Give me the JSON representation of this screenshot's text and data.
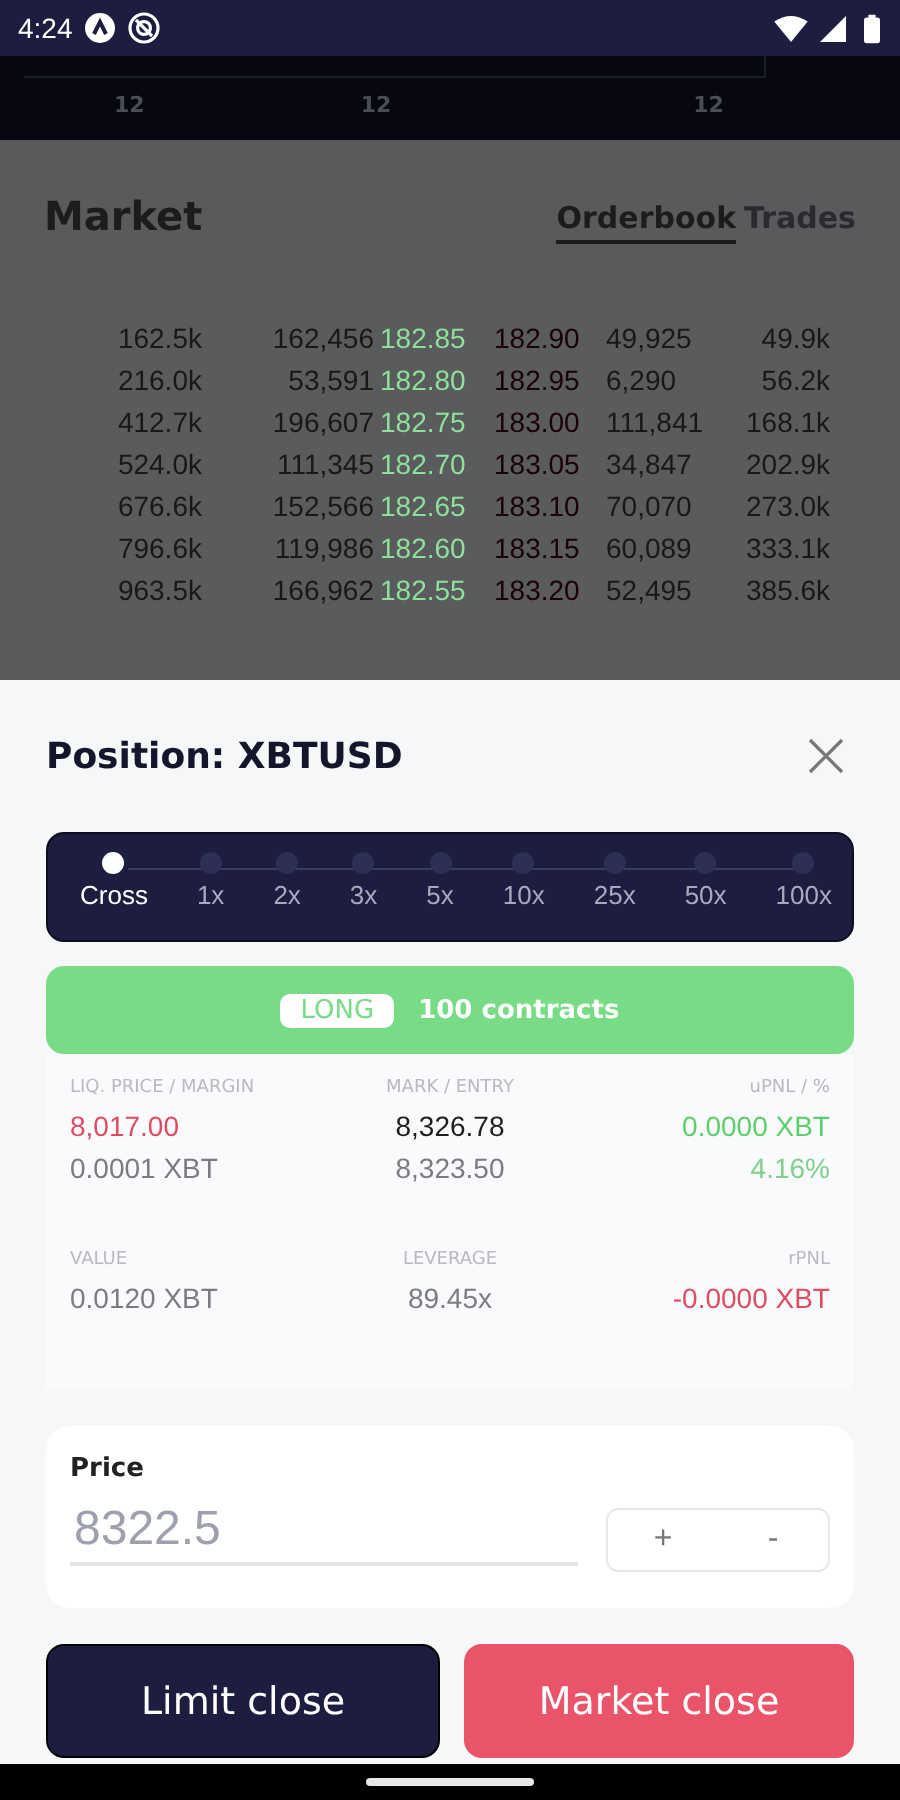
{
  "status_bar": {
    "time": "4:24"
  },
  "chart_axis": {
    "labels": [
      "12",
      "12",
      "12"
    ]
  },
  "market": {
    "title": "Market",
    "tabs": [
      {
        "label": "Orderbook",
        "selected": true
      },
      {
        "label": "Trades",
        "selected": false
      }
    ],
    "orderbook": [
      {
        "bid_total": "162.5k",
        "bid_size": "162,456",
        "bid_price": "182.85",
        "ask_price": "182.90",
        "ask_size": "49,925",
        "ask_total": "49.9k"
      },
      {
        "bid_total": "216.0k",
        "bid_size": "53,591",
        "bid_price": "182.80",
        "ask_price": "182.95",
        "ask_size": "6,290",
        "ask_total": "56.2k"
      },
      {
        "bid_total": "412.7k",
        "bid_size": "196,607",
        "bid_price": "182.75",
        "ask_price": "183.00",
        "ask_size": "111,841",
        "ask_total": "168.1k"
      },
      {
        "bid_total": "524.0k",
        "bid_size": "111,345",
        "bid_price": "182.70",
        "ask_price": "183.05",
        "ask_size": "34,847",
        "ask_total": "202.9k"
      },
      {
        "bid_total": "676.6k",
        "bid_size": "152,566",
        "bid_price": "182.65",
        "ask_price": "183.10",
        "ask_size": "70,070",
        "ask_total": "273.0k"
      },
      {
        "bid_total": "796.6k",
        "bid_size": "119,986",
        "bid_price": "182.60",
        "ask_price": "183.15",
        "ask_size": "60,089",
        "ask_total": "333.1k"
      },
      {
        "bid_total": "963.5k",
        "bid_size": "166,962",
        "bid_price": "182.55",
        "ask_price": "183.20",
        "ask_size": "52,495",
        "ask_total": "385.6k"
      }
    ]
  },
  "sheet": {
    "title": "Position: XBTUSD",
    "leverage_options": [
      {
        "label": "Cross",
        "selected": true
      },
      {
        "label": "1x",
        "selected": false
      },
      {
        "label": "2x",
        "selected": false
      },
      {
        "label": "3x",
        "selected": false
      },
      {
        "label": "5x",
        "selected": false
      },
      {
        "label": "10x",
        "selected": false
      },
      {
        "label": "25x",
        "selected": false
      },
      {
        "label": "50x",
        "selected": false
      },
      {
        "label": "100x",
        "selected": false
      }
    ],
    "side": {
      "badge": "LONG",
      "contracts": "100 contracts"
    },
    "stats": [
      {
        "label": "LIQ. PRICE / MARGIN",
        "values": [
          {
            "text": "8,017.00",
            "color": "#e04a63"
          },
          {
            "text": "0.0001 XBT",
            "color": "#7a7c82"
          }
        ]
      },
      {
        "label": "MARK / ENTRY",
        "values": [
          {
            "text": "8,326.78",
            "color": "#1e1e1e"
          },
          {
            "text": "8,323.50",
            "color": "#7a7c82"
          }
        ]
      },
      {
        "label": "uPNL / %",
        "values": [
          {
            "text": "0.0000 XBT",
            "color": "#5ccf6c"
          },
          {
            "text": "4.16%",
            "color": "#7fcf8b"
          }
        ]
      },
      {
        "label": "VALUE",
        "values": [
          {
            "text": "0.0120 XBT",
            "color": "#7a7c82"
          }
        ]
      },
      {
        "label": "LEVERAGE",
        "values": [
          {
            "text": "89.45x",
            "color": "#7a7c82"
          }
        ]
      },
      {
        "label": "rPNL",
        "values": [
          {
            "text": "-0.0000 XBT",
            "color": "#e04a63"
          }
        ]
      }
    ],
    "price": {
      "label": "Price",
      "placeholder": "8322.5",
      "increment": "+",
      "decrement": "-"
    },
    "buttons": [
      {
        "label": "Limit close",
        "kind": "dark"
      },
      {
        "label": "Market close",
        "kind": "danger"
      }
    ]
  }
}
